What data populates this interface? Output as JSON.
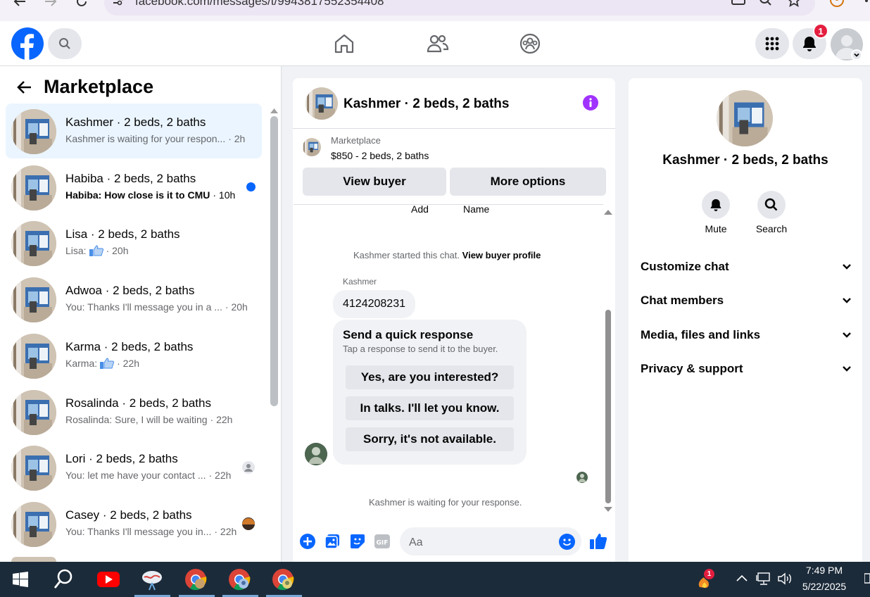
{
  "browser": {
    "url": "facebook.com/messages/t/9943817552354408"
  },
  "topbar": {
    "notification_count": "1"
  },
  "left_panel": {
    "title": "Marketplace",
    "conversations": [
      {
        "name": "Kashmer · 2 beds, 2 baths",
        "preview": "Kashmer is waiting for your respon...",
        "time": "· 2h",
        "unread": false
      },
      {
        "name": "Habiba · 2 beds, 2 baths",
        "preview": "Habiba: How close is it to CMU",
        "time": "· 10h",
        "unread": true
      },
      {
        "name": "Lisa · 2 beds, 2 baths",
        "preview": "Lisa:",
        "time": "· 20h",
        "unread": false
      },
      {
        "name": "Adwoa · 2 beds, 2 baths",
        "preview": "You: Thanks I'll message you in a ...",
        "time": "· 20h",
        "unread": false
      },
      {
        "name": "Karma · 2 beds, 2 baths",
        "preview": "Karma:",
        "time": "· 22h",
        "unread": false
      },
      {
        "name": "Rosalinda · 2 beds, 2 baths",
        "preview": "Rosalinda: Sure, I will be waiting",
        "time": "· 22h",
        "unread": false
      },
      {
        "name": "Lori · 2 beds, 2 baths",
        "preview": "You: let me have your contact ...",
        "time": "· 22h",
        "unread": false
      },
      {
        "name": "Casey · 2 beds, 2 baths",
        "preview": "You: Thanks I'll message you in...",
        "time": "· 22h",
        "unread": false
      }
    ]
  },
  "chat": {
    "title": "Kashmer · 2 beds, 2 baths",
    "marketplace_label": "Marketplace",
    "listing": "$850 - 2 beds, 2 baths",
    "view_buyer": "View buyer",
    "more_options": "More options",
    "cut_off_add": "Add",
    "cut_off_name": "Name",
    "started_text": "Kashmer started this chat.",
    "view_profile": "View buyer profile",
    "sender": "Kashmer",
    "phone_message": "4124208231",
    "quick_title": "Send a quick response",
    "quick_subtitle": "Tap a response to send it to the buyer.",
    "quick_responses": [
      "Yes, are you interested?",
      "In talks. I'll let you know.",
      "Sorry, it's not available."
    ],
    "waiting_text": "Kashmer is waiting for your response.",
    "composer_placeholder": "Aa"
  },
  "info_panel": {
    "name": "Kashmer · 2 beds, 2 baths",
    "mute": "Mute",
    "search": "Search",
    "sections": [
      "Customize chat",
      "Chat members",
      "Media, files and links",
      "Privacy & support"
    ]
  },
  "taskbar": {
    "time": "7:49 PM",
    "date": "5/22/2025",
    "badge": "1"
  },
  "colors": {
    "brand_blue": "#0866ff",
    "active_row": "#ebf5ff",
    "info_purple": "#a033ff",
    "taskbar": "#1c2b3a"
  }
}
